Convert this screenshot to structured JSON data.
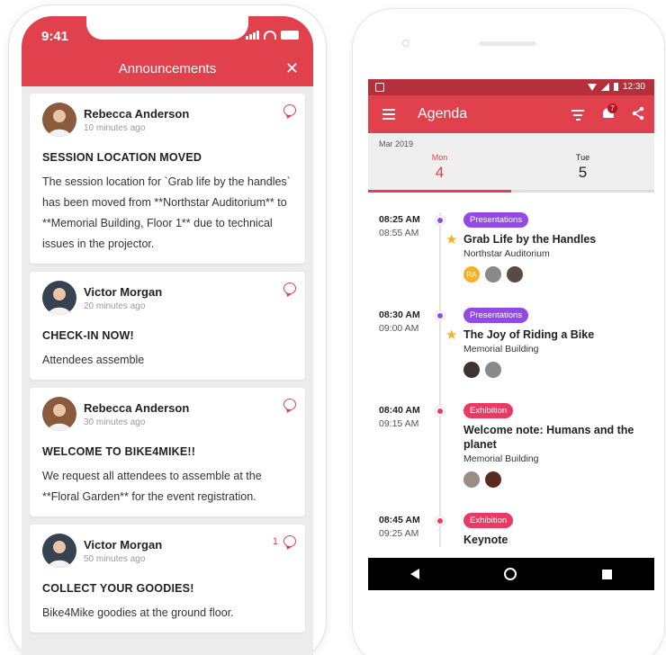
{
  "colors": {
    "brand": "#e0414d",
    "brand_dark": "#b6303c",
    "presentations_tag": "#9249e6",
    "exhibition_tag": "#e83a64",
    "star": "#f4b126"
  },
  "ios": {
    "time": "9:41",
    "title": "Announcements",
    "close_icon": "close-icon",
    "announcements": [
      {
        "author": "Rebecca Anderson",
        "time": "10 minutes ago",
        "comment_count": "",
        "heading": "SESSION LOCATION MOVED",
        "body": "The session location for `Grab life by the handles` has been moved from **Northstar Auditorium** to **Memorial Building, Floor 1** due to technical issues in the projector."
      },
      {
        "author": "Victor Morgan",
        "time": "20 minutes ago",
        "comment_count": "",
        "heading": "CHECK-IN NOW!",
        "body": "Attendees assemble"
      },
      {
        "author": "Rebecca Anderson",
        "time": "30 minutes ago",
        "comment_count": "",
        "heading": "WELCOME TO BIKE4MIKE!!",
        "body": "We request all attendees to assemble at the **Floral Garden** for the event registration."
      },
      {
        "author": "Victor Morgan",
        "time": "50 minutes ago",
        "comment_count": "1",
        "heading": "COLLECT YOUR GOODIES!",
        "body": "Bike4Mike goodies at the ground floor."
      }
    ]
  },
  "android": {
    "status_time": "12:30",
    "title": "Agenda",
    "notification_count": "7",
    "month": "Mar 2019",
    "days": [
      {
        "name": "Mon",
        "num": "4"
      },
      {
        "name": "Tue",
        "num": "5"
      }
    ],
    "sessions": [
      {
        "start": "08:25 AM",
        "end": "08:55 AM",
        "tag": "Presentations",
        "title": "Grab Life by the Handles",
        "venue": "Northstar Auditorium",
        "starred": true,
        "speakers": [
          {
            "initials": "RA",
            "color": "#f4b126"
          },
          {
            "initials": "",
            "color": "#8a8a8a"
          },
          {
            "initials": "",
            "color": "#5a4a44"
          }
        ]
      },
      {
        "start": "08:30 AM",
        "end": "09:00 AM",
        "tag": "Presentations",
        "title": "The Joy of Riding a Bike",
        "venue": "Memorial Building",
        "starred": true,
        "speakers": [
          {
            "initials": "",
            "color": "#3d3430"
          },
          {
            "initials": "",
            "color": "#8a8a8a"
          }
        ]
      },
      {
        "start": "08:40 AM",
        "end": "09:15 AM",
        "tag": "Exhibition",
        "title": "Welcome note: Humans and the planet",
        "venue": "Memorial Building",
        "starred": false,
        "speakers": [
          {
            "initials": "",
            "color": "#9a8d86"
          },
          {
            "initials": "",
            "color": "#5a2a22"
          }
        ]
      },
      {
        "start": "08:45 AM",
        "end": "09:25 AM",
        "tag": "Exhibition",
        "title": "Keynote",
        "venue": "",
        "starred": false,
        "speakers": []
      }
    ]
  }
}
